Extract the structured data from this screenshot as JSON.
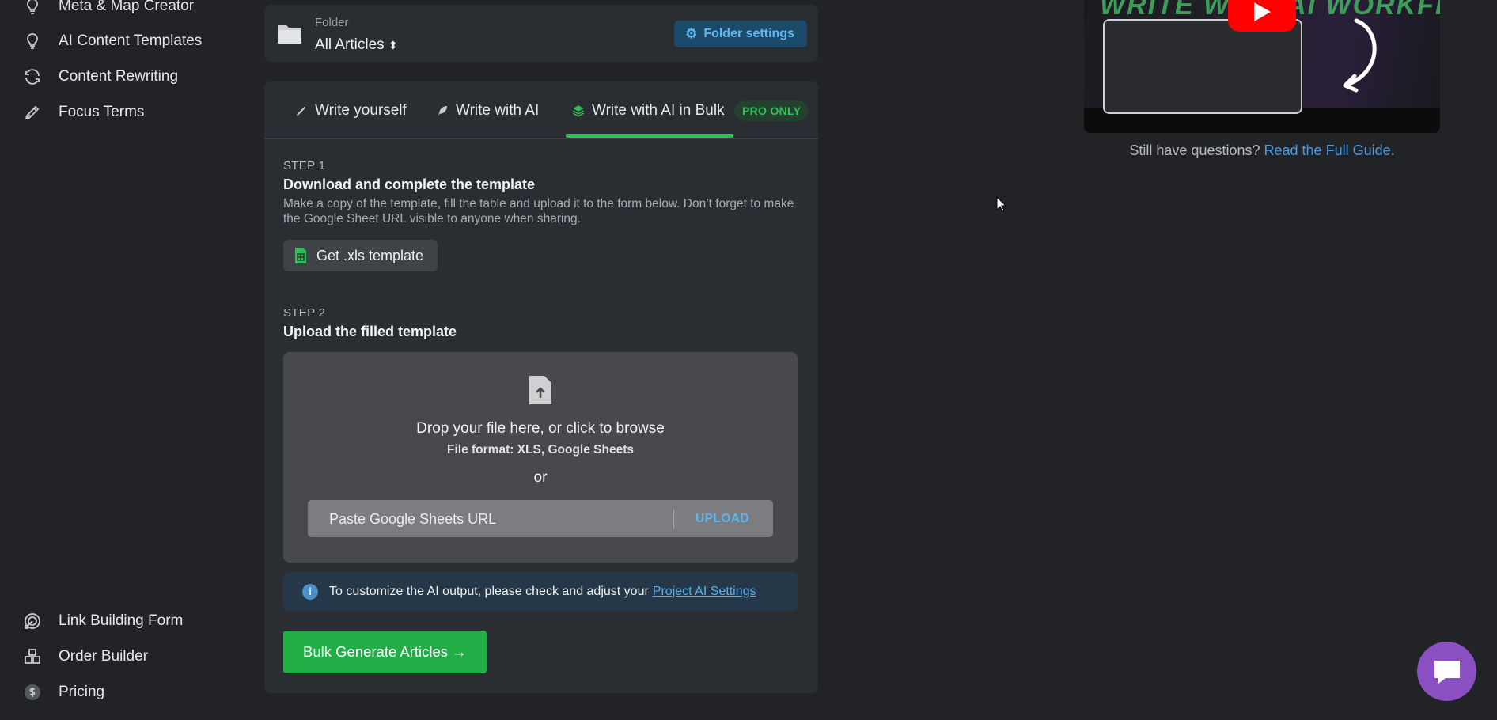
{
  "sidebar": {
    "top_items": [
      {
        "label": "Meta & Map Creator",
        "icon": "bulb-icon"
      },
      {
        "label": "AI Content Templates",
        "icon": "bulb-icon"
      },
      {
        "label": "Content Rewriting",
        "icon": "refresh-icon"
      },
      {
        "label": "Focus Terms",
        "icon": "pen-nib-icon"
      }
    ],
    "bottom_items": [
      {
        "label": "Link Building Form",
        "icon": "target-icon"
      },
      {
        "label": "Order Builder",
        "icon": "boxes-icon"
      },
      {
        "label": "Pricing",
        "icon": "dollar-icon"
      }
    ]
  },
  "folder": {
    "label": "Folder",
    "value": "All Articles",
    "settings_label": "Folder settings"
  },
  "tabs": [
    {
      "label": "Write yourself",
      "icon": "pencil-icon"
    },
    {
      "label": "Write with AI",
      "icon": "feather-icon"
    },
    {
      "label": "Write with AI in Bulk",
      "icon": "layers-icon",
      "active": true
    }
  ],
  "pro_badge": "PRO ONLY",
  "step1": {
    "label": "STEP 1",
    "title": "Download and complete the template",
    "description": "Make a copy of the template, fill the table and upload it to the form below. Don’t forget to make the Google Sheet URL visible to anyone when sharing.",
    "button_label": "Get .xls template"
  },
  "step2": {
    "label": "STEP 2",
    "title": "Upload the filled template",
    "drop_text": "Drop your file here, or",
    "browse_link": "click to browse",
    "format_text": "File format: XLS, Google Sheets",
    "or_text": "or",
    "url_placeholder": "Paste Google Sheets URL",
    "upload_label": "UPLOAD"
  },
  "info": {
    "text": "To customize the AI output, please check and adjust your",
    "link": "Project AI Settings"
  },
  "bulk_button_label": "Bulk Generate Articles →",
  "video": {
    "title_text": "WRITE WITH AI WORKFLOW"
  },
  "help": {
    "question": "Still have questions?",
    "link": "Read the Full Guide."
  },
  "colors": {
    "accent_green": "#22ad47",
    "link_blue": "#55b0ef",
    "background": "#212327",
    "card": "#2a2d31",
    "chat_purple": "#8a4fc0"
  }
}
